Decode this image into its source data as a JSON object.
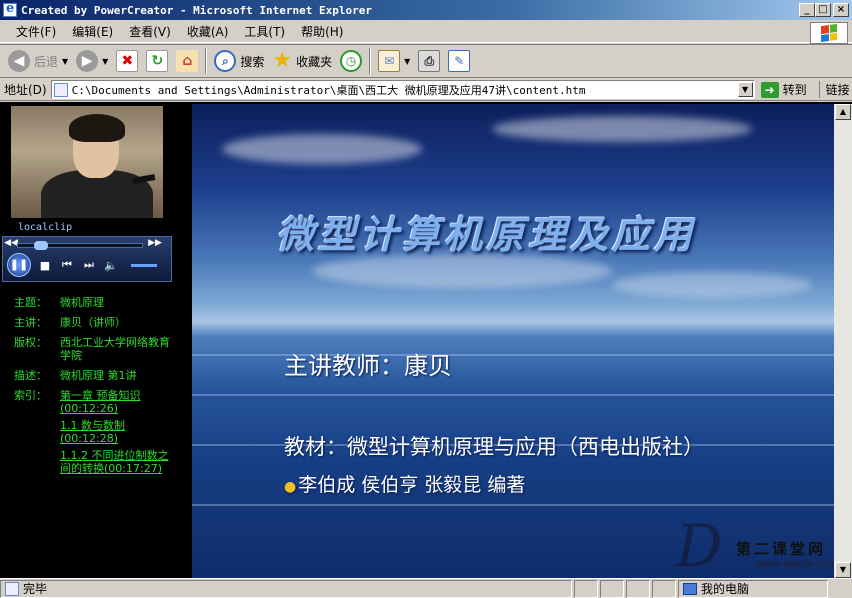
{
  "window": {
    "title": "Created by PowerCreator - Microsoft Internet Explorer"
  },
  "menu": [
    "文件(F)",
    "编辑(E)",
    "查看(V)",
    "收藏(A)",
    "工具(T)",
    "帮助(H)"
  ],
  "toolbar": {
    "back": "后退",
    "search": "搜索",
    "favorites": "收藏夹"
  },
  "address": {
    "label": "地址(D)",
    "url": "C:\\Documents and Settings\\Administrator\\桌面\\西工大 微机原理及应用47讲\\content.htm",
    "go": "转到",
    "links": "链接"
  },
  "video": {
    "label": "localclip"
  },
  "info": {
    "subject_key": "主题：",
    "subject": "微机原理",
    "lecturer_key": "主讲：",
    "lecturer": "康贝（讲师）",
    "copyright_key": "版权：",
    "copyright": "西北工业大学网络教育学院",
    "desc_key": "描述：",
    "desc": "微机原理 第1讲",
    "index_key": "索引：",
    "index": [
      "第一章 预备知识(00:12:26)",
      "1.1 数与数制(00:12:28)",
      "1.1.2 不同进位制数之间的转换(00:17:27)"
    ]
  },
  "slide": {
    "title": "微型计算机原理及应用",
    "lecturer": "主讲教师：康贝",
    "textbook": "教材：微型计算机原理与应用（西电出版社）",
    "authors": "李伯成 侯伯亨 张毅昆 编著",
    "watermark_main": "第二课堂网",
    "watermark_url": "www.dektw.com"
  },
  "status": {
    "left": "完毕",
    "right": "我的电脑"
  }
}
